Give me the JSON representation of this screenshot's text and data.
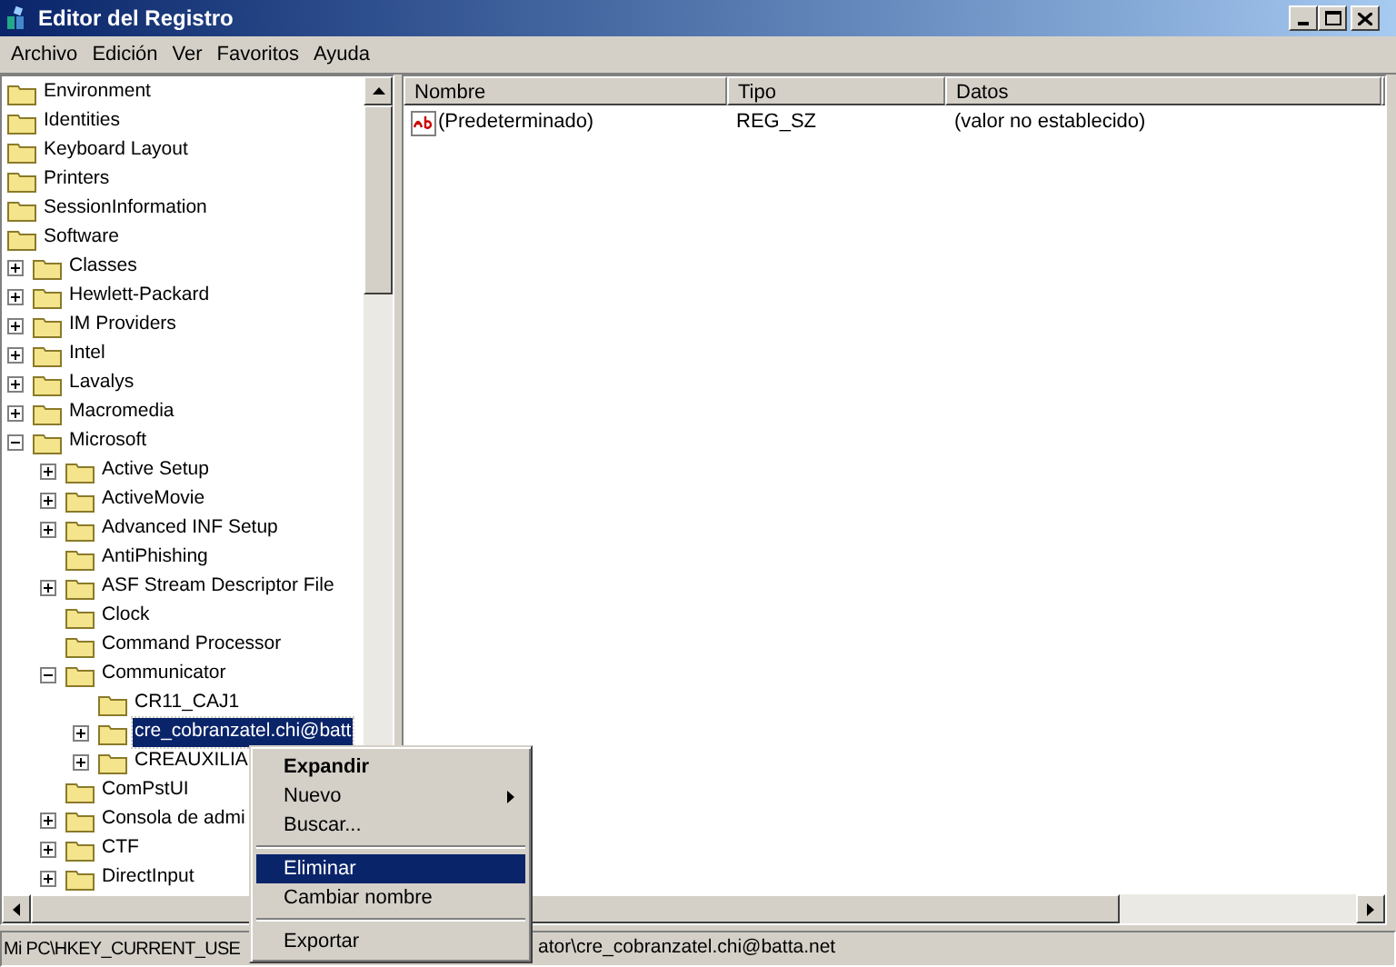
{
  "window": {
    "title": "Editor del Registro"
  },
  "menu_bar": [
    "Archivo",
    "Edición",
    "Ver",
    "Favoritos",
    "Ayuda"
  ],
  "tree": [
    {
      "label": "Environment",
      "selected": false
    },
    {
      "label": "Identities",
      "selected": false
    },
    {
      "label": "Keyboard Layout",
      "selected": false
    },
    {
      "label": "Printers",
      "selected": false
    },
    {
      "label": "SessionInformation",
      "selected": false
    },
    {
      "label": "Software",
      "selected": false,
      "children": [
        {
          "label": "Classes",
          "expanded": false,
          "selected": false
        },
        {
          "label": "Hewlett-Packard",
          "expanded": false,
          "selected": false
        },
        {
          "label": "IM Providers",
          "expanded": false,
          "selected": false
        },
        {
          "label": "Intel",
          "expanded": false,
          "selected": false
        },
        {
          "label": "Lavalys",
          "expanded": false,
          "selected": false
        },
        {
          "label": "Macromedia",
          "expanded": false,
          "selected": false
        },
        {
          "label": "Microsoft",
          "expanded": true,
          "selected": false,
          "children": [
            {
              "label": "Active Setup",
              "expanded": false,
              "selected": false
            },
            {
              "label": "ActiveMovie",
              "expanded": false,
              "selected": false
            },
            {
              "label": "Advanced INF Setup",
              "expanded": false,
              "selected": false
            },
            {
              "label": "AntiPhishing",
              "selected": false
            },
            {
              "label": "ASF Stream Descriptor File",
              "expanded": false,
              "selected": false
            },
            {
              "label": "Clock",
              "selected": false
            },
            {
              "label": "Command Processor",
              "selected": false
            },
            {
              "label": "Communicator",
              "expanded": true,
              "selected": false,
              "children": [
                {
                  "label": "CR11_CAJ1",
                  "selected": false
                },
                {
                  "label": "cre_cobranzatel.chi@batt",
                  "expanded": false,
                  "selected": true
                },
                {
                  "label": "CREAUXILIA",
                  "expanded": false,
                  "selected": false
                }
              ]
            },
            {
              "label": "ComPstUI",
              "selected": false
            },
            {
              "label": "Consola de admi",
              "expanded": false,
              "selected": false
            },
            {
              "label": "CTF",
              "expanded": false,
              "selected": false
            },
            {
              "label": "DirectInput",
              "expanded": false,
              "selected": false
            }
          ]
        }
      ]
    }
  ],
  "list": {
    "columns": [
      "Nombre",
      "Tipo",
      "Datos"
    ],
    "rows": [
      {
        "name": "(Predeterminado)",
        "type": "REG_SZ",
        "data": "(valor no establecido)"
      }
    ]
  },
  "status_bar": [
    "Mi PC\\HKEY_CURRENT_USE",
    "ator\\cre_cobranzatel.chi@batta.net"
  ],
  "context_menu": [
    {
      "kind": "item",
      "label": "Expandir",
      "default": true,
      "submenu": false,
      "selected": false
    },
    {
      "kind": "item",
      "label": "Nuevo",
      "default": false,
      "submenu": true,
      "selected": false
    },
    {
      "kind": "item",
      "label": "Buscar...",
      "default": false,
      "submenu": false,
      "selected": false
    },
    {
      "kind": "separator"
    },
    {
      "kind": "item",
      "label": "Eliminar",
      "default": false,
      "submenu": false,
      "selected": true
    },
    {
      "kind": "item",
      "label": "Cambiar nombre",
      "default": false,
      "submenu": false,
      "selected": false
    },
    {
      "kind": "separator"
    },
    {
      "kind": "item",
      "label": "Exportar",
      "default": false,
      "submenu": false,
      "selected": false
    }
  ]
}
